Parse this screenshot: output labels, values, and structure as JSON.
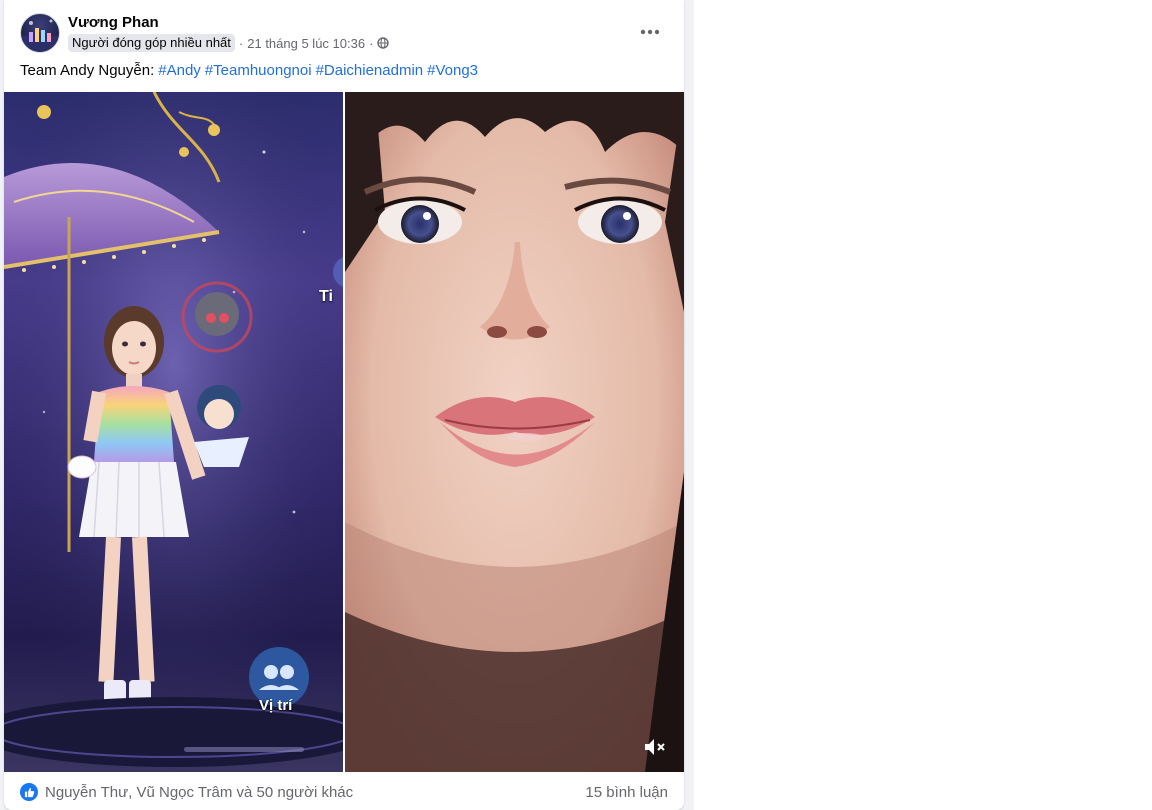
{
  "post": {
    "author": "Vương Phan",
    "badge": "Người đóng góp nhiều nhất",
    "timestamp": "21 tháng 5 lúc 10:36",
    "separator": "·",
    "privacy_icon": "globe-icon",
    "more_icon": "more-horizontal-icon",
    "text_prefix": "Team Andy Nguyễn:",
    "hashtags": [
      "#Andy",
      "#Teamhuongnoi",
      "#Daichienadmin",
      "#Vong3"
    ]
  },
  "media": {
    "left_image_label": "game-character-screenshot",
    "left_overlay_text": "Vị trí",
    "left_edge_text": "Ti",
    "right_image_label": "selfie-video",
    "mute_icon": "volume-muted-icon"
  },
  "footer": {
    "reaction_icon": "like-icon",
    "reactors": "Nguyễn Thư, Vũ Ngọc Trâm và 50 người khác",
    "comments": "15 bình luận"
  },
  "colors": {
    "link": "#216fdb",
    "secondary_text": "#65676b",
    "like_blue": "#1877f2",
    "feed_background": "#f0f2f5"
  }
}
